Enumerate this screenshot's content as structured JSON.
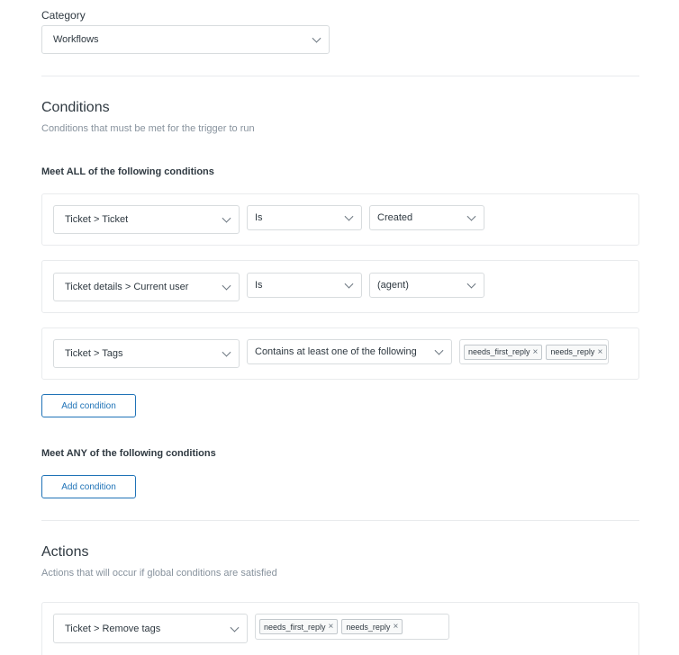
{
  "category": {
    "label": "Category",
    "value": "Workflows"
  },
  "conditions": {
    "title": "Conditions",
    "subtitle": "Conditions that must be met for the trigger to run",
    "all": {
      "title": "Meet ALL of the following conditions",
      "rows": [
        {
          "field": "Ticket > Ticket",
          "operator": "Is",
          "value": "Created"
        },
        {
          "field": "Ticket details > Current user",
          "operator": "Is",
          "value": "(agent)"
        },
        {
          "field": "Ticket > Tags",
          "operator": "Contains at least one of the following",
          "tags": [
            "needs_first_reply",
            "needs_reply"
          ]
        }
      ],
      "add_label": "Add condition"
    },
    "any": {
      "title": "Meet ANY of the following conditions",
      "add_label": "Add condition"
    }
  },
  "actions": {
    "title": "Actions",
    "subtitle": "Actions that will occur if global conditions are satisfied",
    "rows": [
      {
        "field": "Ticket > Remove tags",
        "tags": [
          "needs_first_reply",
          "needs_reply"
        ]
      }
    ]
  },
  "colors": {
    "border": "#d8dcde",
    "card_border": "#e9ebed",
    "accent": "#1f73b7",
    "muted": "#87929d"
  }
}
